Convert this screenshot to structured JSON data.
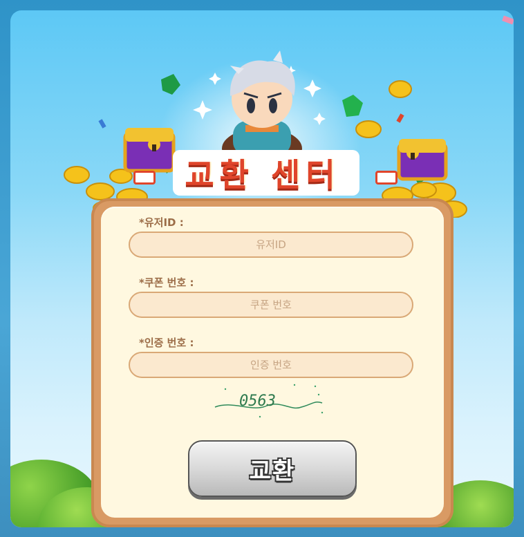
{
  "title": "- 교환 센터 -",
  "title_text": "교환 센터",
  "form": {
    "user_id_label": "*유저ID :",
    "user_id_placeholder": "유저ID",
    "coupon_label": "*쿠폰 번호 :",
    "coupon_placeholder": "쿠폰 번호",
    "verify_label": "*인증 번호 :",
    "verify_placeholder": "인증 번호",
    "captcha_text": "0563",
    "submit_label": "교환"
  },
  "colors": {
    "title_red": "#e0452b",
    "card_border": "#d99a64",
    "card_bg": "#fff8e0",
    "input_bg": "#fbe9cf",
    "label": "#9c6d48"
  },
  "icons": [
    "treasure-chest-icon",
    "coin-icon",
    "gem-icon",
    "sparkle-icon",
    "character-mascot"
  ]
}
